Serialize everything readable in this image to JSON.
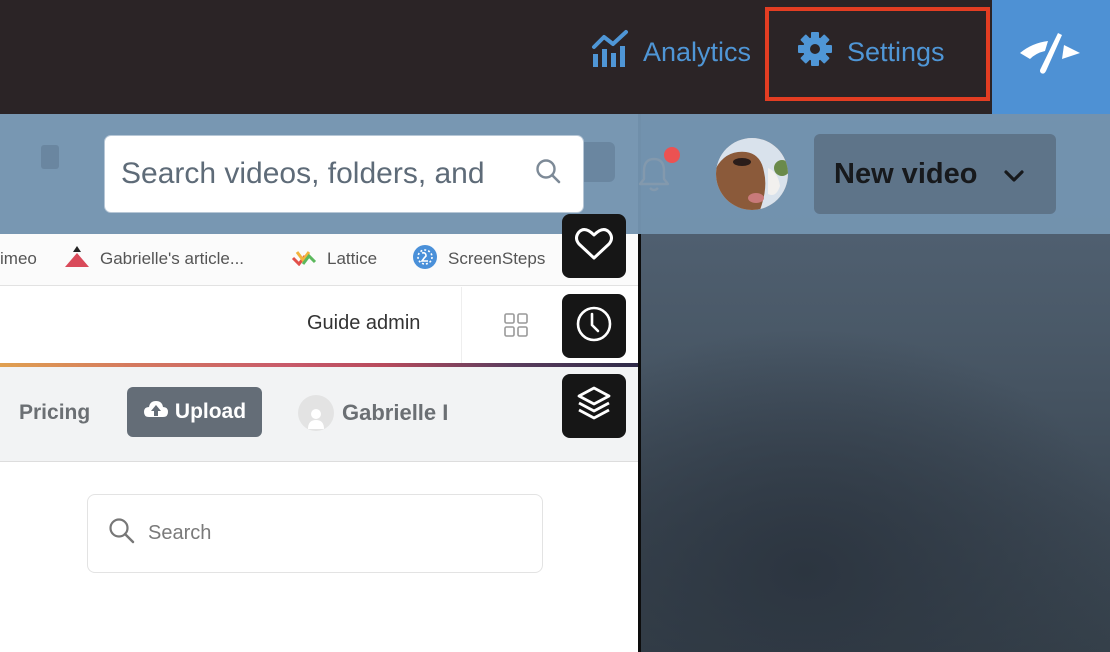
{
  "topbar": {
    "nav": [
      {
        "label": "Analytics",
        "icon": "analytics-chart-icon"
      },
      {
        "label": "Settings",
        "icon": "gear-icon",
        "highlighted": true
      }
    ],
    "logo_icon": "speedometer-logo-icon",
    "accent_color": "#4f96d6",
    "highlight_color": "#e33d22"
  },
  "header": {
    "search_placeholder": "Search videos, folders, and",
    "notification_badge": true,
    "new_video_label": "New video"
  },
  "bookmarks": [
    {
      "label": "imeo",
      "icon": "vimeo-icon"
    },
    {
      "label": "Gabrielle's article...",
      "icon": "triangle-logo-icon"
    },
    {
      "label": "Lattice",
      "icon": "lattice-icon"
    },
    {
      "label": "ScreenSteps",
      "icon": "screensteps-icon"
    }
  ],
  "guide_row": {
    "guide_admin_label": "Guide admin"
  },
  "subnav": {
    "pricing_label": "Pricing",
    "upload_label": "Upload",
    "user_name": "Gabrielle I"
  },
  "content": {
    "search_placeholder": "Search"
  },
  "side_buttons": [
    {
      "icon": "heart-icon"
    },
    {
      "icon": "clock-icon"
    },
    {
      "icon": "layers-icon"
    }
  ]
}
